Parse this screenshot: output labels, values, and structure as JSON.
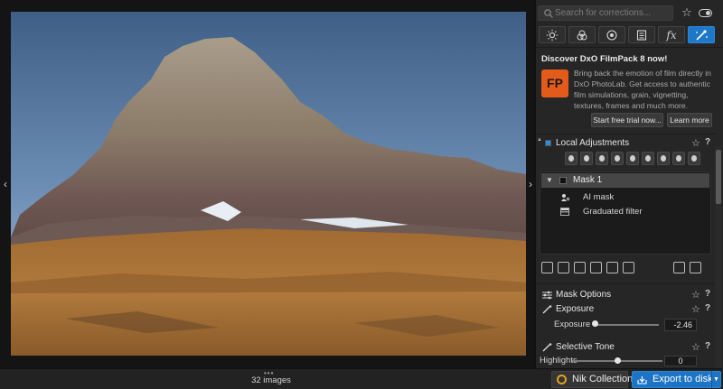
{
  "search": {
    "placeholder": "Search for corrections..."
  },
  "icons": {
    "search": "search-icon",
    "favorite": "star-icon",
    "toggle": "toggle-icon",
    "tabs": [
      "sun-icon",
      "color-circles-icon",
      "detail-icon",
      "geometry-icon",
      "fx-icon",
      "local-adjustments-icon"
    ]
  },
  "tabs": {
    "fx_label": "fx"
  },
  "promo": {
    "title": "Discover DxO FilmPack 8 now!",
    "logo_text": "FP",
    "text": "Bring back the emotion of film directly in DxO PhotoLab. Get access to authentic film simulations, grain, vignetting, textures, frames and much more.",
    "trial_button": "Start free trial now...",
    "learn_button": "Learn more"
  },
  "local_adjustments": {
    "title": "Local Adjustments",
    "star": "☆",
    "help": "?",
    "masks": [
      {
        "name": "Mask 1",
        "items": [
          {
            "label": "AI mask",
            "icon": "ai-mask-icon"
          },
          {
            "label": "Graduated filter",
            "icon": "graduated-filter-icon"
          }
        ]
      }
    ]
  },
  "mask_options": {
    "title": "Mask Options",
    "star": "☆",
    "help": "?"
  },
  "exposure": {
    "title": "Exposure",
    "star": "☆",
    "help": "?",
    "slider_label": "Exposure",
    "value": "-2.46",
    "fraction": 0.0
  },
  "selective_tone": {
    "title": "Selective Tone",
    "star": "☆",
    "help": "?",
    "highlights_label": "Highlights",
    "highlights_value": "0"
  },
  "viewer": {
    "dots": "•••",
    "image_count": "32 images",
    "nav_left": "‹",
    "nav_right": "›"
  },
  "bottom": {
    "nik_label": "Nik Collection",
    "export_label": "Export to disk",
    "export_menu": "▼"
  },
  "colors": {
    "accent": "#1e78c8",
    "filmpack": "#e35b1b",
    "nik": "#e3a21a",
    "slider_fill": "#2e8ee6"
  }
}
